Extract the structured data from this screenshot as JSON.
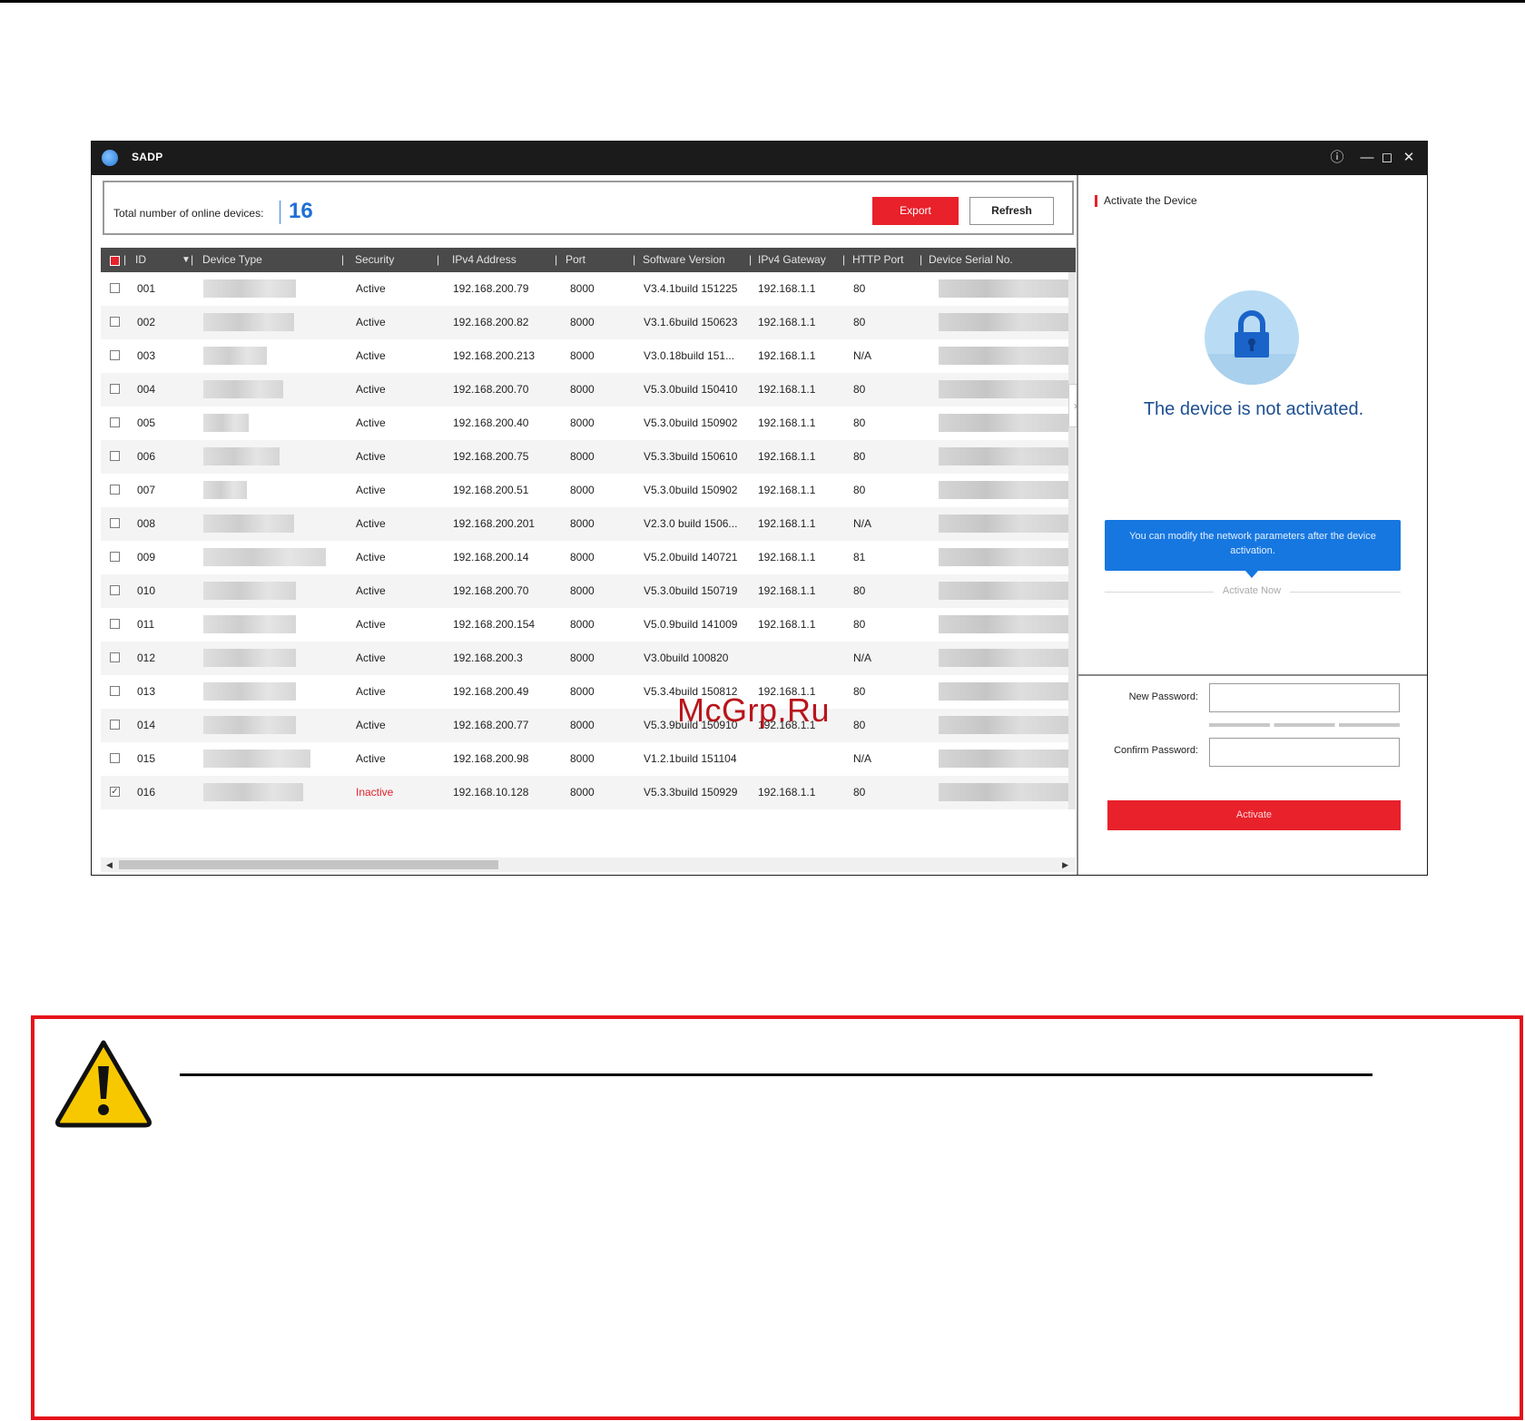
{
  "window": {
    "title": "SADP",
    "controls": [
      "info-icon",
      "minimize-icon",
      "maximize-icon",
      "close-icon"
    ]
  },
  "summary": {
    "label": "Total number of online devices:",
    "count": "16"
  },
  "toolbar": {
    "export_label": "Export",
    "refresh_label": "Refresh"
  },
  "table": {
    "columns": [
      "ID",
      "Device Type",
      "Security",
      "IPv4 Address",
      "Port",
      "Software Version",
      "IPv4 Gateway",
      "HTTP Port",
      "Device Serial No."
    ],
    "rows": [
      {
        "checked": false,
        "id": "001",
        "security": "Active",
        "ip": "192.168.200.79",
        "port": "8000",
        "version": "V3.4.1build 151225",
        "gateway": "192.168.1.1",
        "http": "80"
      },
      {
        "checked": false,
        "id": "002",
        "security": "Active",
        "ip": "192.168.200.82",
        "port": "8000",
        "version": "V3.1.6build 150623",
        "gateway": "192.168.1.1",
        "http": "80"
      },
      {
        "checked": false,
        "id": "003",
        "security": "Active",
        "ip": "192.168.200.213",
        "port": "8000",
        "version": "V3.0.18build 151...",
        "gateway": "192.168.1.1",
        "http": "N/A"
      },
      {
        "checked": false,
        "id": "004",
        "security": "Active",
        "ip": "192.168.200.70",
        "port": "8000",
        "version": "V5.3.0build 150410",
        "gateway": "192.168.1.1",
        "http": "80"
      },
      {
        "checked": false,
        "id": "005",
        "security": "Active",
        "ip": "192.168.200.40",
        "port": "8000",
        "version": "V5.3.0build 150902",
        "gateway": "192.168.1.1",
        "http": "80"
      },
      {
        "checked": false,
        "id": "006",
        "security": "Active",
        "ip": "192.168.200.75",
        "port": "8000",
        "version": "V5.3.3build 150610",
        "gateway": "192.168.1.1",
        "http": "80"
      },
      {
        "checked": false,
        "id": "007",
        "security": "Active",
        "ip": "192.168.200.51",
        "port": "8000",
        "version": "V5.3.0build 150902",
        "gateway": "192.168.1.1",
        "http": "80"
      },
      {
        "checked": false,
        "id": "008",
        "security": "Active",
        "ip": "192.168.200.201",
        "port": "8000",
        "version": "V2.3.0 build 1506...",
        "gateway": "192.168.1.1",
        "http": "N/A"
      },
      {
        "checked": false,
        "id": "009",
        "security": "Active",
        "ip": "192.168.200.14",
        "port": "8000",
        "version": "V5.2.0build 140721",
        "gateway": "192.168.1.1",
        "http": "81"
      },
      {
        "checked": false,
        "id": "010",
        "security": "Active",
        "ip": "192.168.200.70",
        "port": "8000",
        "version": "V5.3.0build 150719",
        "gateway": "192.168.1.1",
        "http": "80"
      },
      {
        "checked": false,
        "id": "011",
        "security": "Active",
        "ip": "192.168.200.154",
        "port": "8000",
        "version": "V5.0.9build 141009",
        "gateway": "192.168.1.1",
        "http": "80"
      },
      {
        "checked": false,
        "id": "012",
        "security": "Active",
        "ip": "192.168.200.3",
        "port": "8000",
        "version": "V3.0build 100820",
        "gateway": "",
        "http": "N/A"
      },
      {
        "checked": false,
        "id": "013",
        "security": "Active",
        "ip": "192.168.200.49",
        "port": "8000",
        "version": "V5.3.4build 150812",
        "gateway": "192.168.1.1",
        "http": "80"
      },
      {
        "checked": false,
        "id": "014",
        "security": "Active",
        "ip": "192.168.200.77",
        "port": "8000",
        "version": "V5.3.9build 150910",
        "gateway": "192.168.1.1",
        "http": "80"
      },
      {
        "checked": false,
        "id": "015",
        "security": "Active",
        "ip": "192.168.200.98",
        "port": "8000",
        "version": "V1.2.1build 151104",
        "gateway": "",
        "http": "N/A"
      },
      {
        "checked": true,
        "id": "016",
        "security": "Inactive",
        "ip": "192.168.10.128",
        "port": "8000",
        "version": "V5.3.3build 150929",
        "gateway": "192.168.1.1",
        "http": "80"
      }
    ]
  },
  "activate_panel": {
    "title": "Activate the Device",
    "status": "The device is not activated.",
    "tooltip": "You can modify the network parameters after the device activation.",
    "activate_now": "Activate Now",
    "new_password_label": "New Password:",
    "confirm_password_label": "Confirm Password:",
    "activate_label": "Activate"
  },
  "watermark": "McGrp.Ru",
  "colors": {
    "accent_red": "#e8212b",
    "accent_blue": "#1677e0",
    "titlebar": "#1b1b1b",
    "warning_border": "#e5121b"
  },
  "warning": {
    "icon": "warning-triangle-icon"
  }
}
